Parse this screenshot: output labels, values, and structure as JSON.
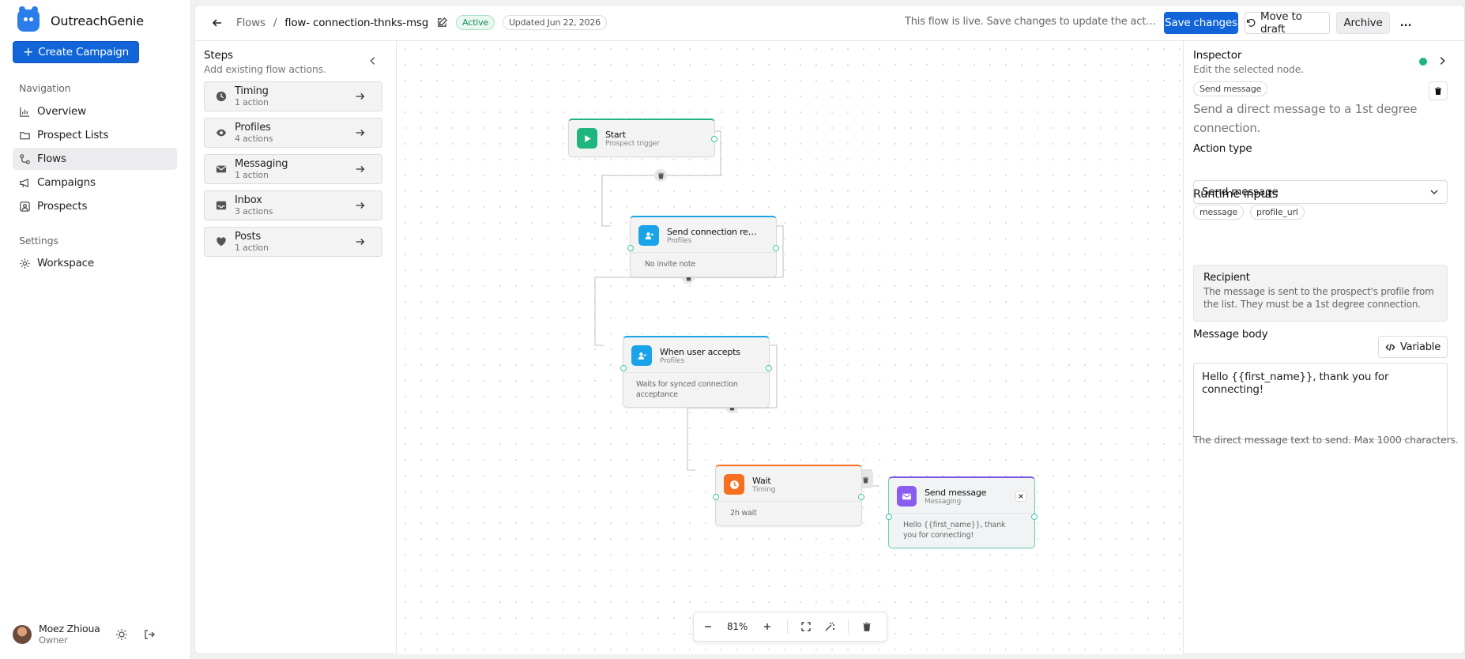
{
  "app": {
    "name": "OutreachGenie",
    "create_campaign_label": "Create Campaign"
  },
  "sidebar": {
    "nav_label": "Navigation",
    "items": [
      {
        "label": "Overview",
        "icon": "chart-icon"
      },
      {
        "label": "Prospect Lists",
        "icon": "folder-icon"
      },
      {
        "label": "Flows",
        "icon": "flow-icon",
        "active": true
      },
      {
        "label": "Campaigns",
        "icon": "megaphone-icon"
      },
      {
        "label": "Prospects",
        "icon": "user-square-icon"
      }
    ],
    "settings_label": "Settings",
    "settings_items": [
      {
        "label": "Workspace",
        "icon": "gear-icon"
      }
    ],
    "user": {
      "name": "Moez Zhioua",
      "role": "Owner"
    }
  },
  "topbar": {
    "crumb_root": "Flows",
    "separator": "/",
    "flow_name": "flow- connection-thnks-msg",
    "status": "Active",
    "updated": "Updated Jun 22, 2026",
    "live_note": "This flow is live. Save changes to update the active version.",
    "save_label": "Save changes",
    "draft_label": "Move to draft",
    "archive_label": "Archive",
    "more_label": "..."
  },
  "steps_panel": {
    "title": "Steps",
    "subtitle": "Add existing flow actions.",
    "items": [
      {
        "name": "Timing",
        "count": "1 action",
        "icon": "clock-icon"
      },
      {
        "name": "Profiles",
        "count": "4 actions",
        "icon": "eye-icon"
      },
      {
        "name": "Messaging",
        "count": "1 action",
        "icon": "mail-icon"
      },
      {
        "name": "Inbox",
        "count": "3 actions",
        "icon": "inbox-icon"
      },
      {
        "name": "Posts",
        "count": "1 action",
        "icon": "heart-icon"
      }
    ]
  },
  "canvas": {
    "nodes": [
      {
        "title": "Start",
        "subtitle": "Prospect trigger",
        "body": "",
        "accent": "#1fb57e"
      },
      {
        "title": "Send connection request",
        "subtitle": "Profiles",
        "body": "No invite note",
        "accent": "#1aa3e8"
      },
      {
        "title": "When user accepts",
        "subtitle": "Profiles",
        "body": "Waits for synced connection acceptance",
        "accent": "#1aa3e8"
      },
      {
        "title": "Wait",
        "subtitle": "Timing",
        "body": "2h wait",
        "accent": "#f5701f"
      },
      {
        "title": "Send message",
        "subtitle": "Messaging",
        "body": "Hello {{first_name}}, thank you for connecting!",
        "accent": "#7b55e8"
      }
    ],
    "zoom": "81%"
  },
  "inspector": {
    "title": "Inspector",
    "subtitle": "Edit the selected node.",
    "node_chip": "Send message",
    "description": "Send a direct message to a 1st degree connection.",
    "action_type_label": "Action type",
    "action_type_value": "Send message",
    "runtime_label": "Runtime inputs",
    "runtime_inputs": [
      "message",
      "profile_url"
    ],
    "recipient_title": "Recipient",
    "recipient_text": "The message is sent to the prospect's profile from the list. They must be a 1st degree connection.",
    "message_body_label": "Message body",
    "variable_label": "Variable",
    "message_body": "Hello {{first_name}}, thank you for connecting!",
    "helper": "The direct message text to send. Max 1000 characters."
  },
  "colors": {
    "primary": "#1265d9",
    "active_green": "#1fb57e"
  }
}
